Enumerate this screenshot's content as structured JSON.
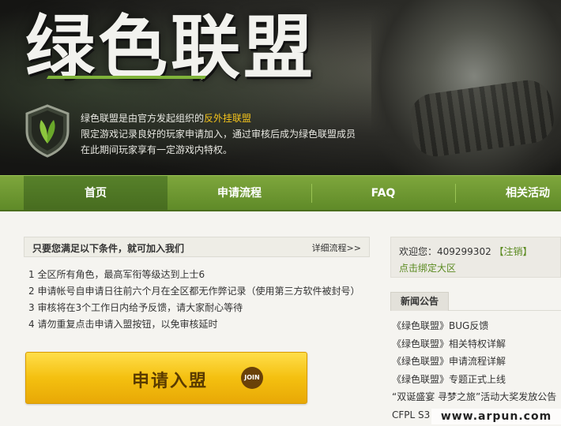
{
  "banner": {
    "title": "绿色联盟",
    "intro_line1_prefix": "绿色联盟是由官方发起组织的",
    "intro_line1_highlight": "反外挂联盟",
    "intro_line2": "限定游戏记录良好的玩家申请加入，通过审核后成为绿色联盟成员",
    "intro_line3": "在此期间玩家享有一定游戏内特权。"
  },
  "nav": {
    "items": [
      {
        "label": "首页",
        "active": true
      },
      {
        "label": "申请流程"
      },
      {
        "label": "FAQ"
      },
      {
        "label": "相关活动"
      }
    ]
  },
  "conditions": {
    "title": "只要您满足以下条件，就可加入我们",
    "more": "详细流程>>",
    "items": [
      "1  全区所有角色，最高军衔等级达到上士6",
      "2  申请帐号自申请日往前六个月在全区都无作弊记录（使用第三方软件被封号）",
      "3  审核将在3个工作日内给予反馈，请大家耐心等待",
      "4  请勿重复点击申请入盟按钮，以免审核延时"
    ]
  },
  "apply": {
    "label": "申请入盟",
    "badge": "JOIN"
  },
  "user": {
    "welcome_prefix": "欢迎您：409299302",
    "logout": "【注销】",
    "bind": "点击绑定大区"
  },
  "news": {
    "tab": "新闻公告",
    "items": [
      "《绿色联盟》BUG反馈",
      "《绿色联盟》相关特权详解",
      "《绿色联盟》申请流程详解",
      "《绿色联盟》专题正式上线",
      "“双诞盛宴 寻梦之旅”活动大奖发放公告",
      "CFPL S3"
    ]
  },
  "watermark": "www.arpun.com"
}
